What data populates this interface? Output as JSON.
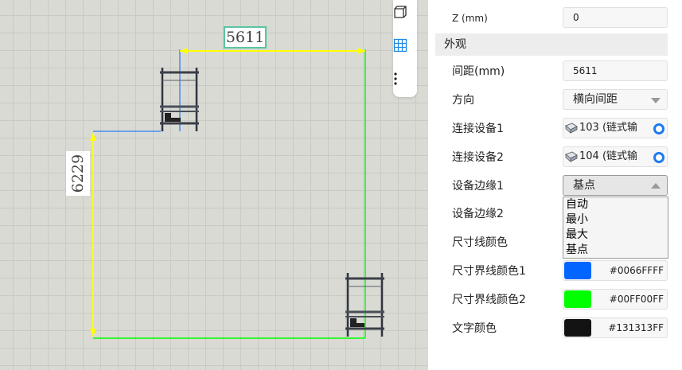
{
  "canvas": {
    "dim_width_label": "5611",
    "dim_height_label": "6229",
    "colors": {
      "dimension_line": "#ffff00",
      "extension_line_1": "#0066ff",
      "extension_line_2": "#00ff00",
      "text": "#131313"
    }
  },
  "toolbar": {
    "icons": [
      "cube-icon",
      "grid-icon",
      "more-vertical-icon"
    ]
  },
  "panel": {
    "z": {
      "label": "Z (mm)",
      "value": "0"
    },
    "section_appearance": "外观",
    "spacing": {
      "label": "间距(mm)",
      "value": "5611"
    },
    "direction": {
      "label": "方向",
      "value": "横向间距"
    },
    "device1": {
      "label": "连接设备1",
      "value": "103 (链式输"
    },
    "device2": {
      "label": "连接设备2",
      "value": "104 (链式输"
    },
    "edge1": {
      "label": "设备边缘1",
      "value": "基点",
      "options": [
        "自动",
        "最小",
        "最大",
        "基点"
      ]
    },
    "edge2": {
      "label": "设备边缘2"
    },
    "dim_line_color": {
      "label": "尺寸线颜色"
    },
    "ext_color1": {
      "label": "尺寸界线颜色1",
      "hex": "#0066FFFF",
      "color": "#0066ff"
    },
    "ext_color2": {
      "label": "尺寸界线颜色2",
      "hex": "#00FF00FF",
      "color": "#00ff00"
    },
    "text_color": {
      "label": "文字颜色",
      "hex": "#131313FF",
      "color": "#131313"
    }
  }
}
